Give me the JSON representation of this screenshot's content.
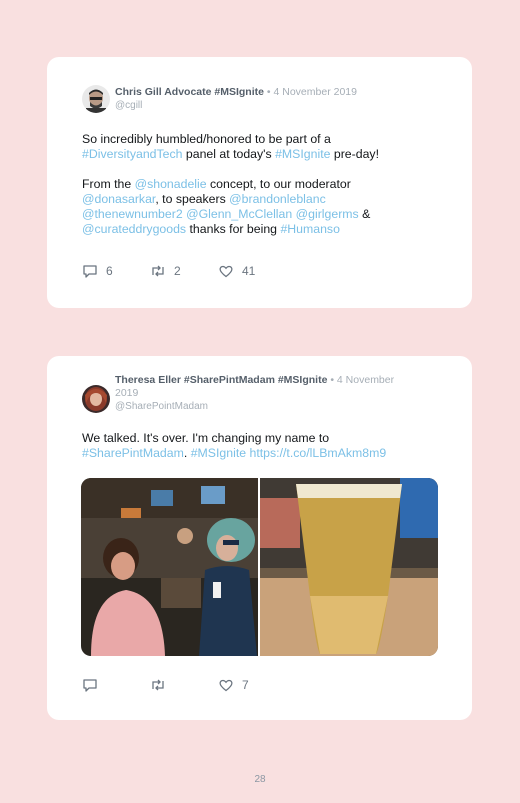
{
  "tweet1": {
    "author": "Chris Gill Advocate #MSIgnite",
    "sep": " • ",
    "date": "4 November 2019",
    "handle": "@cgill",
    "line1a": "So incredibly humbled/honored to be part of a",
    "line2_tag1": "#DiversityandTech",
    "line2_mid": " panel at today's ",
    "line2_tag2": "#MSIgnite",
    "line2_end": " pre-day!",
    "p2_a": "From the ",
    "p2_m1": "@shonadelie",
    "p2_b": " concept, to our moderator",
    "p2_m2": "@donasarkar",
    "p2_c": ", to speakers ",
    "p2_m3": "@brandonleblanc",
    "p2_m4": "@thenewnumber2",
    "p2_m5": "@Glenn_McClellan",
    "p2_m6": "@girlgerms",
    "p2_d": " &",
    "p2_m7": "@curateddrygoods",
    "p2_e": " thanks for being ",
    "p2_tag": "#Humanso",
    "replies": "6",
    "retweets": "2",
    "likes": "41"
  },
  "tweet2": {
    "author": "Theresa Eller #SharePintMadam #MSIgnite",
    "sep": " • ",
    "date": "4 November 2019",
    "handle": "@SharePointMadam",
    "line1": "We talked. It's over. I'm changing my name to",
    "tag1": "#SharePintMadam",
    "dot": ". ",
    "tag2": "#MSIgnite",
    "url": "https://t.co/lLBmAkm8m9",
    "likes": "7"
  },
  "page_number": "28",
  "colors": {
    "link": "#7cc0e6",
    "background": "#f9e0e0",
    "card": "#ffffff"
  },
  "icons": [
    "reply-icon",
    "retweet-icon",
    "like-icon"
  ]
}
